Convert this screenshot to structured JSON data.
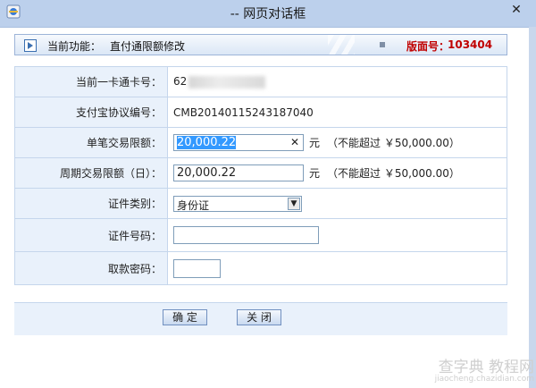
{
  "window": {
    "title": "-- 网页对话框",
    "close_glyph": "✕"
  },
  "func_bar": {
    "label": "当前功能：",
    "value": "直付通限额修改",
    "page_label": "版面号：",
    "page_number": "103404"
  },
  "form": {
    "card": {
      "label": "当前一卡通卡号：",
      "value": "62"
    },
    "agreement": {
      "label": "支付宝协议编号：",
      "value": "CMB20140115243187040"
    },
    "single_limit": {
      "label": "单笔交易限额：",
      "value": "20,000.22",
      "unit": "元",
      "hint": "（不能超过 ￥50,000.00）"
    },
    "weekly_limit": {
      "label": "周期交易限额（日）：",
      "value": "20,000.22",
      "unit": "元",
      "hint": "（不能超过 ￥50,000.00）"
    },
    "id_type": {
      "label": "证件类别：",
      "selected": "身份证"
    },
    "id_number": {
      "label": "证件号码：",
      "value": ""
    },
    "password": {
      "label": "取款密码：",
      "value": ""
    }
  },
  "buttons": {
    "confirm": "确 定",
    "close": "关 闭"
  },
  "watermark": {
    "main": "查字典 教程网",
    "sub": "jiaocheng.chazidian.com"
  }
}
